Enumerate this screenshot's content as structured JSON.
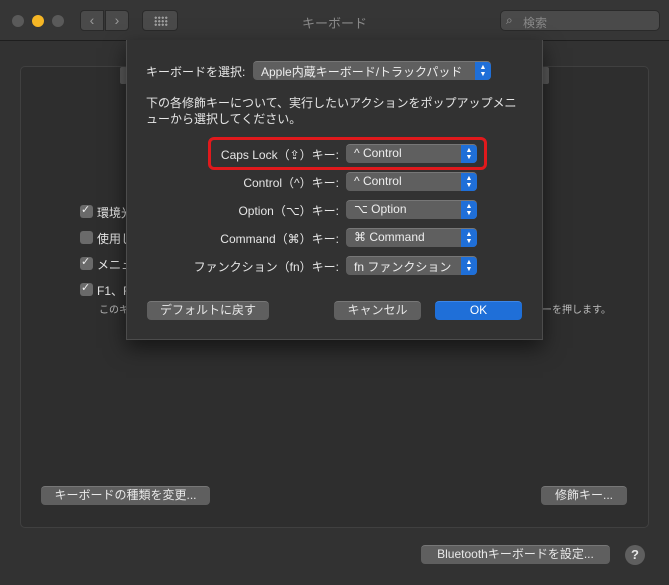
{
  "window": {
    "title": "キーボード",
    "search_placeholder": "検索",
    "nav_back": "‹",
    "nav_forward": "›",
    "help": "?"
  },
  "background_panel": {
    "checkboxes": [
      {
        "label": "環境光",
        "checked": true
      },
      {
        "label": "使用し",
        "checked": false
      },
      {
        "label": "メニュ",
        "checked": true
      },
      {
        "label": "F1、F",
        "checked": true
      }
    ],
    "note_left": "このキ",
    "note_right": "ーを押します。",
    "change_keyboard_type_button": "キーボードの種類を変更...",
    "modifier_keys_button": "修飾キー...",
    "bluetooth_button": "Bluetoothキーボードを設定..."
  },
  "sheet": {
    "keyboard_select_label": "キーボードを選択:",
    "keyboard_select_value": "Apple内蔵キーボード/トラックパッド",
    "instructions_line1": "下の各修飾キーについて、実行したいアクションをポップアップメニ",
    "instructions_line2": "ューから選択してください。",
    "rows": [
      {
        "label": "Caps Lock（⇪）キー:",
        "value": "^ Control"
      },
      {
        "label": "Control（^）キー:",
        "value": "^ Control"
      },
      {
        "label": "Option（⌥）キー:",
        "value": "⌥ Option"
      },
      {
        "label": "Command（⌘）キー:",
        "value": "⌘ Command"
      },
      {
        "label": "ファンクション（fn）キー:",
        "value": "fn ファンクション"
      }
    ],
    "restore_defaults_button": "デフォルトに戻す",
    "cancel_button": "キャンセル",
    "ok_button": "OK"
  },
  "colors": {
    "accent": "#1f6fd8",
    "highlight": "#e0191c",
    "window_background": "#323232"
  }
}
